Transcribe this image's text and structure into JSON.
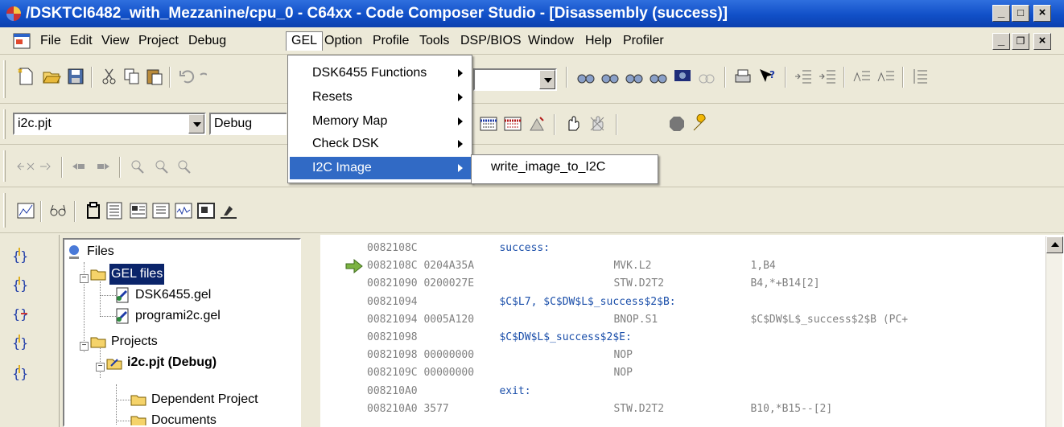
{
  "window": {
    "title": "/DSKTCI6482_with_Mezzanine/cpu_0 - C64xx - Code Composer Studio - [Disassembly (success)]",
    "buttons": [
      "_",
      "□",
      "×"
    ]
  },
  "menubar": {
    "items": [
      "File",
      "Edit",
      "View",
      "Project",
      "Debug",
      "GEL",
      "Option",
      "Profile",
      "Tools",
      "DSP/BIOS",
      "Window",
      "Help",
      "Profiler"
    ],
    "open_menu": "GEL"
  },
  "gel_menu": {
    "items": [
      {
        "label": "DSK6455 Functions",
        "submenu": true
      },
      {
        "label": "Resets",
        "submenu": true
      },
      {
        "label": "Memory Map",
        "submenu": true
      },
      {
        "label": "Check DSK",
        "submenu": true
      },
      {
        "label": "I2C Image",
        "submenu": true,
        "highlighted": true
      }
    ],
    "submenu_items": [
      "write_image_to_I2C"
    ]
  },
  "toolbars": {
    "project_combo": "i2c.pjt",
    "config_combo": "Debug"
  },
  "project_tree": {
    "items": [
      {
        "label": "Files",
        "icon": "files-root-icon"
      },
      {
        "label": "GEL files",
        "icon": "folder-open-icon",
        "selected": true
      },
      {
        "label": "DSK6455.gel",
        "icon": "gel-file-icon"
      },
      {
        "label": "programi2c.gel",
        "icon": "gel-file-icon"
      },
      {
        "label": "Projects",
        "icon": "folder-open-icon"
      },
      {
        "label": "i2c.pjt (Debug)",
        "icon": "project-icon",
        "bold": true
      },
      {
        "label": "Dependent Project",
        "icon": "folder-icon"
      },
      {
        "label": "Documents",
        "icon": "folder-icon"
      }
    ]
  },
  "disassembly": {
    "current_line_index": 1,
    "rows": [
      {
        "addr": "0082108C",
        "op": "",
        "text": "success:",
        "label": true
      },
      {
        "addr": "0082108C",
        "op": "0204A35A",
        "mnem": "MVK.L2",
        "args": "1,B4"
      },
      {
        "addr": "00821090",
        "op": "0200027E",
        "mnem": "STW.D2T2",
        "args": "B4,*+B14[2]"
      },
      {
        "addr": "00821094",
        "op": "",
        "text": "$C$L7, $C$DW$L$_success$2$B:",
        "label": true
      },
      {
        "addr": "00821094",
        "op": "0005A120",
        "mnem": "BNOP.S1",
        "args": "$C$DW$L$_success$2$B (PC+"
      },
      {
        "addr": "00821098",
        "op": "",
        "text": "$C$DW$L$_success$2$E:",
        "label": true
      },
      {
        "addr": "00821098",
        "op": "00000000",
        "mnem": "NOP",
        "args": ""
      },
      {
        "addr": "0082109C",
        "op": "00000000",
        "mnem": "NOP",
        "args": ""
      },
      {
        "addr": "008210A0",
        "op": "",
        "text": "exit:",
        "label": true
      },
      {
        "addr": "008210A0",
        "op": "3577",
        "mnem": "STW.D2T2",
        "args": "B10,*B15--[2]"
      }
    ]
  },
  "colors": {
    "titlebar": "#1150c8",
    "menu_highlight": "#316ac5",
    "tree_selection": "#0a246a",
    "disasm_label": "#1b4faa",
    "disasm_text": "#808080",
    "current_line_arrow": "#7cb342"
  }
}
